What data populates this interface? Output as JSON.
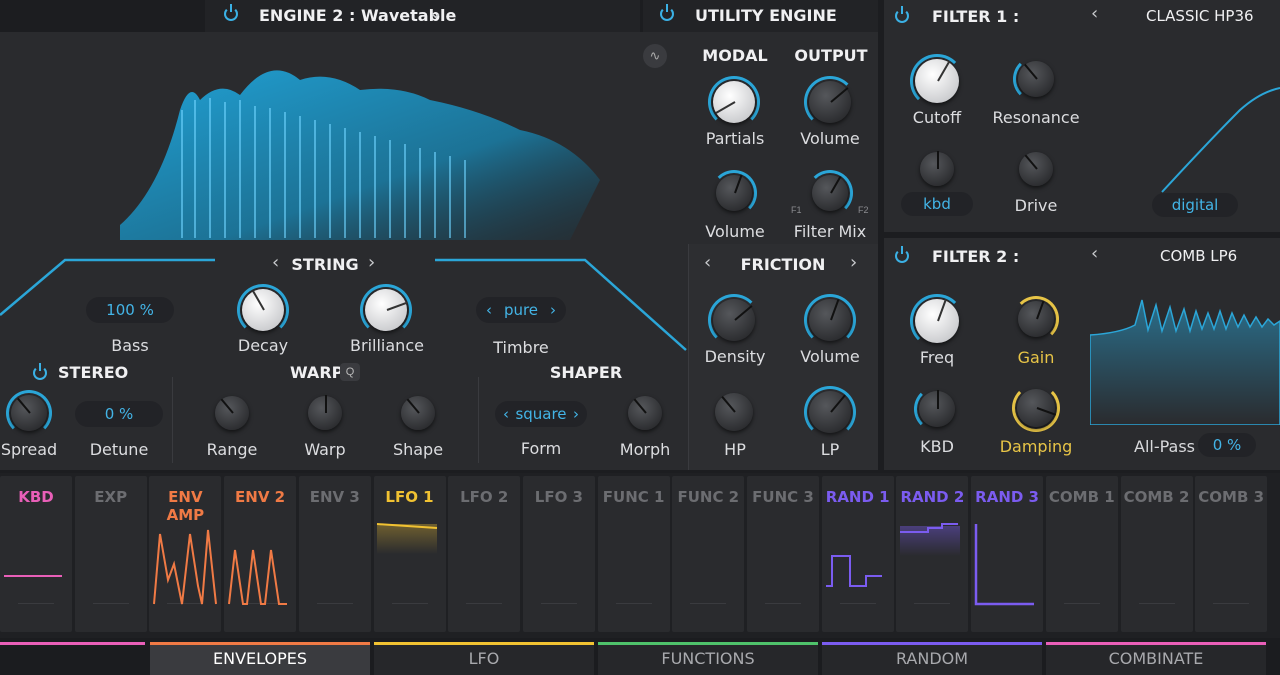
{
  "engine2": {
    "title": "ENGINE 2 : Wavetable",
    "modal_label": "MODAL",
    "output_label": "OUTPUT"
  },
  "utility": {
    "title": "UTILITY ENGINE"
  },
  "modal": {
    "partials": "Partials",
    "volume": "Volume"
  },
  "output": {
    "volume": "Volume",
    "filter_mix": "Filter Mix",
    "f1": "F1",
    "f2": "F2"
  },
  "string": {
    "title": "STRING",
    "bass_value": "100 %",
    "bass": "Bass",
    "decay": "Decay",
    "brilliance": "Brilliance",
    "timbre_value": "pure",
    "timbre": "Timbre"
  },
  "friction": {
    "title": "FRICTION",
    "density": "Density",
    "volume": "Volume",
    "hp": "HP",
    "lp": "LP"
  },
  "stereo": {
    "title": "STEREO",
    "spread": "Spread",
    "detune_value": "0 %",
    "detune": "Detune"
  },
  "warp": {
    "title": "WARP",
    "q_badge": "Q",
    "range": "Range",
    "warp": "Warp",
    "shape": "Shape"
  },
  "shaper": {
    "title": "SHAPER",
    "form_value": "square",
    "form": "Form",
    "morph": "Morph"
  },
  "filter1": {
    "title": "FILTER 1 :",
    "type": "CLASSIC HP36",
    "cutoff": "Cutoff",
    "resonance": "Resonance",
    "kbd_value": "kbd",
    "drive": "Drive",
    "mode_value": "digital"
  },
  "filter2": {
    "title": "FILTER 2 :",
    "type": "COMB LP6",
    "freq": "Freq",
    "gain": "Gain",
    "kbd": "KBD",
    "damping": "Damping",
    "allpass": "All-Pass",
    "allpass_value": "0 %"
  },
  "mod_sources": [
    {
      "label": "KBD",
      "color": "#e95fb8"
    },
    {
      "label": "EXP",
      "color": "#6c6d71"
    },
    {
      "label": "ENV AMP",
      "color": "#f07a45"
    },
    {
      "label": "ENV 2",
      "color": "#f07a45"
    },
    {
      "label": "ENV 3",
      "color": "#6c6d71"
    },
    {
      "label": "LFO 1",
      "color": "#f1c232"
    },
    {
      "label": "LFO 2",
      "color": "#6c6d71"
    },
    {
      "label": "LFO 3",
      "color": "#6c6d71"
    },
    {
      "label": "FUNC 1",
      "color": "#6c6d71"
    },
    {
      "label": "FUNC 2",
      "color": "#6c6d71"
    },
    {
      "label": "FUNC 3",
      "color": "#6c6d71"
    },
    {
      "label": "RAND 1",
      "color": "#7b5cf0"
    },
    {
      "label": "RAND 2",
      "color": "#7b5cf0"
    },
    {
      "label": "RAND 3",
      "color": "#7b5cf0"
    },
    {
      "label": "COMB 1",
      "color": "#6c6d71"
    },
    {
      "label": "COMB 2",
      "color": "#6c6d71"
    },
    {
      "label": "COMB 3",
      "color": "#6c6d71"
    }
  ],
  "tabs": [
    {
      "label": "ENVELOPES",
      "color": "#f07a45",
      "active": true
    },
    {
      "label": "LFO",
      "color": "#f1c232",
      "active": false
    },
    {
      "label": "FUNCTIONS",
      "color": "#4fc26b",
      "active": false
    },
    {
      "label": "RANDOM",
      "color": "#7b5cf0",
      "active": false
    },
    {
      "label": "COMBINATE",
      "color": "#e95fb8",
      "active": false
    }
  ],
  "colors": {
    "accent": "#3bb1e5",
    "yellow": "#e8c547"
  }
}
